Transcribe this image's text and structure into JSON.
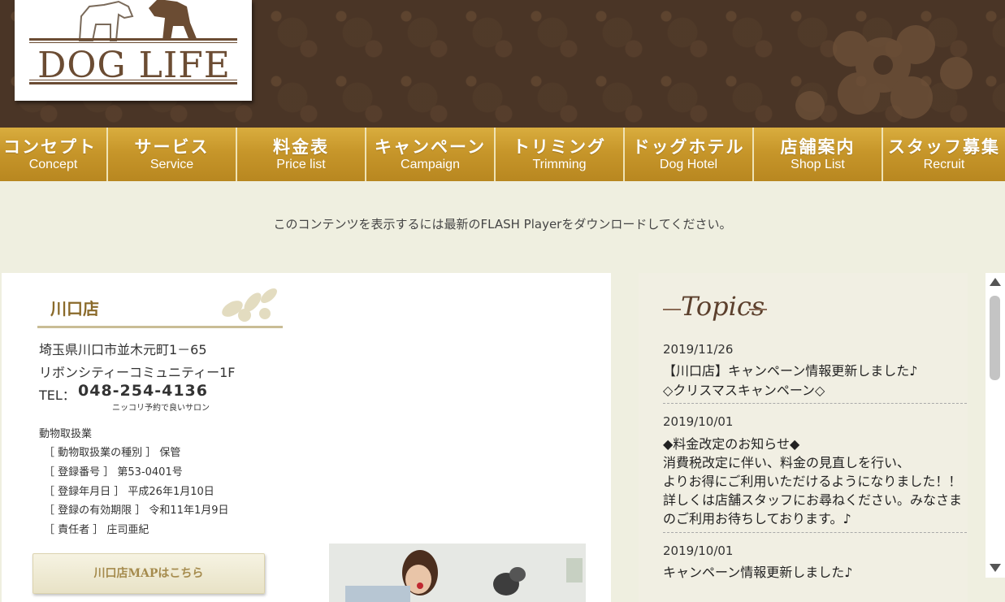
{
  "logo": {
    "text": "DOG LIFE"
  },
  "nav": [
    {
      "jp": "コンセプト",
      "en": "Concept"
    },
    {
      "jp": "サービス",
      "en": "Service"
    },
    {
      "jp": "料金表",
      "en": "Price list"
    },
    {
      "jp": "キャンペーン",
      "en": "Campaign"
    },
    {
      "jp": "トリミング",
      "en": "Trimming"
    },
    {
      "jp": "ドッグホテル",
      "en": "Dog Hotel"
    },
    {
      "jp": "店舗案内",
      "en": "Shop List"
    },
    {
      "jp": "スタッフ募集",
      "en": "Recruit"
    }
  ],
  "flash_message": "このコンテンツを表示するには最新のFLASH Playerをダウンロードしてください。",
  "shop": {
    "title": "川口店",
    "address1": "埼玉県川口市並木元町1－65",
    "address2": "リボンシティーコミュニティー1F",
    "tel_label": "TEL：",
    "tel": "048-254-4136",
    "tel_sub": "ニッコリ予約で良いサロン",
    "reg_heading": "動物取扱業",
    "reg_items": [
      "［ 動物取扱業の種別 ］ 保管",
      "［ 登録番号 ］ 第53-0401号",
      "［ 登録年月日 ］ 平成26年1月10日",
      "［ 登録の有効期限 ］ 令和11年1月9日",
      "［ 責任者 ］ 庄司亜紀"
    ],
    "map_button": "川口店MAPはこちら"
  },
  "topics": {
    "title": "Topics",
    "entries": [
      {
        "date": "2019/11/26",
        "lines": [
          "【川口店】キャンペーン情報更新しました♪",
          "◇クリスマスキャンペーン◇"
        ]
      },
      {
        "date": "2019/10/01",
        "lines": [
          "◆料金改定のお知らせ◆",
          "消費税改定に伴い、料金の見直しを行い、",
          "よりお得にご利用いただけるようになりました！！",
          "詳しくは店舗スタッフにお尋ねください。みなさま",
          "のご利用お待ちしております。♪"
        ]
      },
      {
        "date": "2019/10/01",
        "lines": [
          "キャンペーン情報更新しました♪"
        ]
      }
    ]
  },
  "colors": {
    "header_bg": "#4a3526",
    "nav_gold": "#c7962a",
    "page_bg": "#efefe0",
    "topics_bg": "#f1efe3"
  }
}
